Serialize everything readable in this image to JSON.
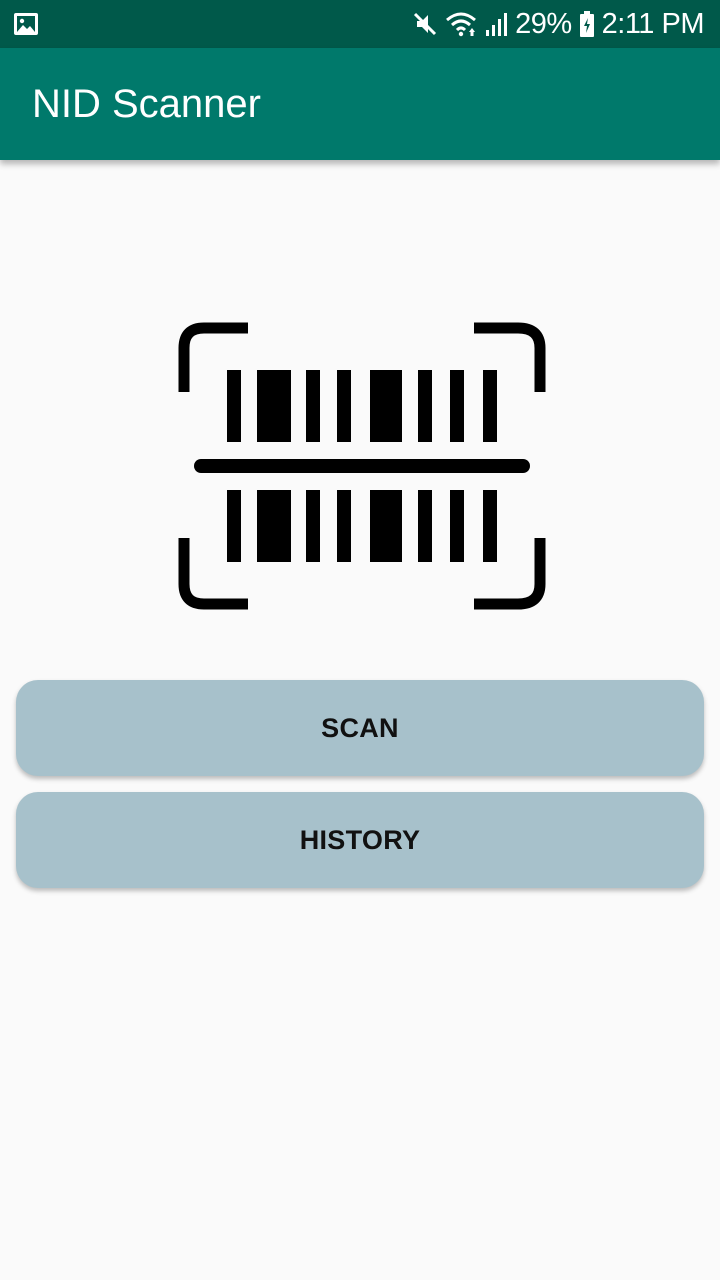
{
  "status_bar": {
    "left_icon": "gallery-icon",
    "icons": [
      "mute-icon",
      "wifi-icon",
      "signal-icon",
      "battery-icon"
    ],
    "battery_percent": "29%",
    "time": "2:11 PM"
  },
  "app_bar": {
    "title": "NID Scanner",
    "color": "#00796b"
  },
  "main": {
    "illustration": "barcode-scanner-icon",
    "scan_button": "SCAN",
    "history_button": "HISTORY",
    "button_color": "#a7c1cb"
  }
}
